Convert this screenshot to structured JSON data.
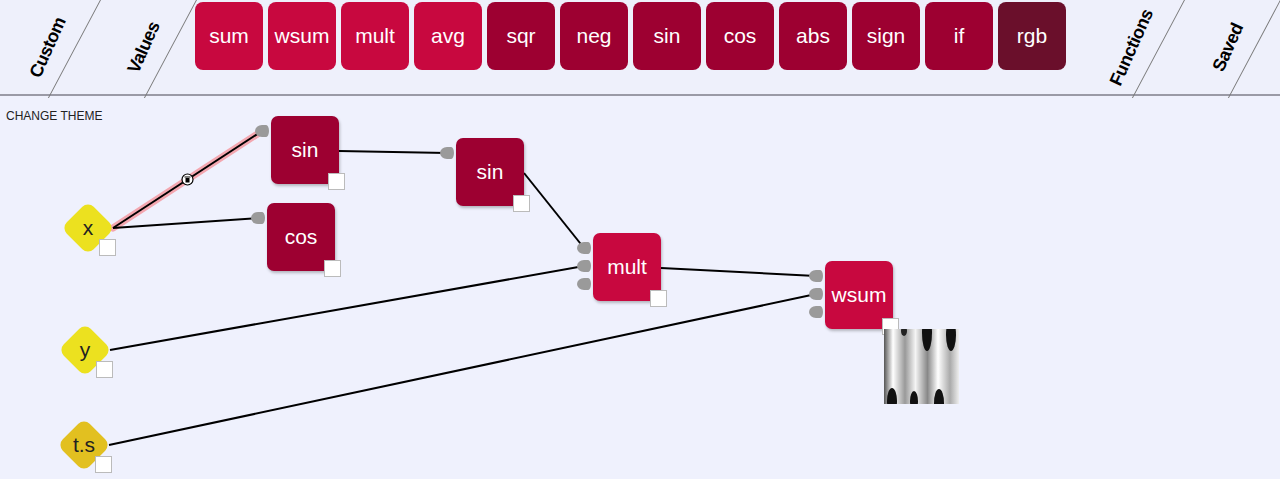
{
  "toolbar": {
    "left_tabs": [
      {
        "label": "Custom"
      },
      {
        "label": "Values"
      }
    ],
    "functions": [
      {
        "label": "sum",
        "color": "#c8083f"
      },
      {
        "label": "wsum",
        "color": "#c8083f"
      },
      {
        "label": "mult",
        "color": "#c8083f"
      },
      {
        "label": "avg",
        "color": "#c8083f"
      },
      {
        "label": "sqr",
        "color": "#9d0031"
      },
      {
        "label": "neg",
        "color": "#9d0031"
      },
      {
        "label": "sin",
        "color": "#9d0031"
      },
      {
        "label": "cos",
        "color": "#9d0031"
      },
      {
        "label": "abs",
        "color": "#9d0031"
      },
      {
        "label": "sign",
        "color": "#9d0031"
      },
      {
        "label": "if",
        "color": "#9d0031"
      },
      {
        "label": "rgb",
        "color": "#6a0f2b"
      }
    ],
    "right_tabs": [
      {
        "label": "Functions"
      },
      {
        "label": "Saved"
      }
    ]
  },
  "canvas": {
    "theme_button": "CHANGE THEME",
    "nodes": [
      {
        "label": "x",
        "kind": "input",
        "color": "#ece11f",
        "ports": 0,
        "preview": false
      },
      {
        "label": "y",
        "kind": "input",
        "color": "#ece11f",
        "ports": 0,
        "preview": false
      },
      {
        "label": "t.s",
        "kind": "input",
        "color": "#e2c020",
        "ports": 0,
        "preview": false
      },
      {
        "label": "sin",
        "kind": "function",
        "color": "#9d0031",
        "ports": 1,
        "preview": false
      },
      {
        "label": "cos",
        "kind": "function",
        "color": "#9d0031",
        "ports": 1,
        "preview": false
      },
      {
        "label": "sin",
        "kind": "function",
        "color": "#9d0031",
        "ports": 1,
        "preview": false
      },
      {
        "label": "mult",
        "kind": "function",
        "color": "#c8083f",
        "ports": 3,
        "preview": false
      },
      {
        "label": "wsum",
        "kind": "function",
        "color": "#c8083f",
        "ports": 3,
        "preview": true
      }
    ],
    "edges": [
      {
        "from": 0,
        "to": 3,
        "port": 0,
        "selected": true
      },
      {
        "from": 0,
        "to": 4,
        "port": 0,
        "selected": false
      },
      {
        "from": 3,
        "to": 5,
        "port": 0,
        "selected": false
      },
      {
        "from": 5,
        "to": 6,
        "port": 0,
        "selected": false
      },
      {
        "from": 1,
        "to": 6,
        "port": 1,
        "selected": false
      },
      {
        "from": 6,
        "to": 7,
        "port": 0,
        "selected": false
      },
      {
        "from": 2,
        "to": 7,
        "port": 1,
        "selected": false
      }
    ]
  }
}
